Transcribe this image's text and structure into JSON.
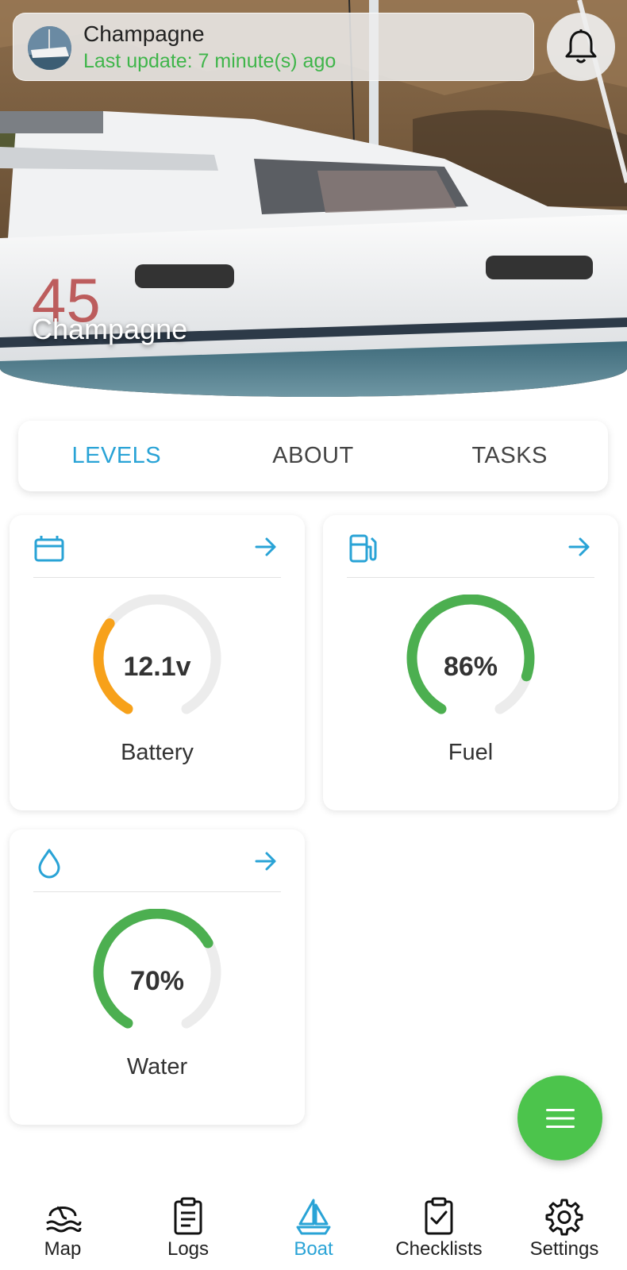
{
  "header": {
    "boat_name": "Champagne",
    "last_update": "Last update: 7 minute(s) ago",
    "notification_icon": "bell-icon"
  },
  "hero": {
    "title": "Champagne"
  },
  "tabs": [
    {
      "label": "LEVELS",
      "active": true
    },
    {
      "label": "ABOUT",
      "active": false
    },
    {
      "label": "TASKS",
      "active": false
    }
  ],
  "levels": [
    {
      "icon": "battery-icon",
      "value": "12.1v",
      "label": "Battery",
      "fraction": 0.32,
      "color": "#f7a11a"
    },
    {
      "icon": "fuel-pump-icon",
      "value": "86%",
      "label": "Fuel",
      "fraction": 0.86,
      "color": "#4caf50"
    },
    {
      "icon": "water-drop-icon",
      "value": "70%",
      "label": "Water",
      "fraction": 0.7,
      "color": "#4caf50"
    }
  ],
  "colors": {
    "accent": "#29a3d6",
    "green": "#4cc44c",
    "gauge_track": "#ececec"
  },
  "fab": {
    "icon": "menu-icon"
  },
  "bottom_nav": [
    {
      "label": "Map",
      "icon": "map-icon",
      "active": false
    },
    {
      "label": "Logs",
      "icon": "logs-clipboard-icon",
      "active": false
    },
    {
      "label": "Boat",
      "icon": "sailboat-icon",
      "active": true
    },
    {
      "label": "Checklists",
      "icon": "checklist-icon",
      "active": false
    },
    {
      "label": "Settings",
      "icon": "gear-icon",
      "active": false
    }
  ]
}
